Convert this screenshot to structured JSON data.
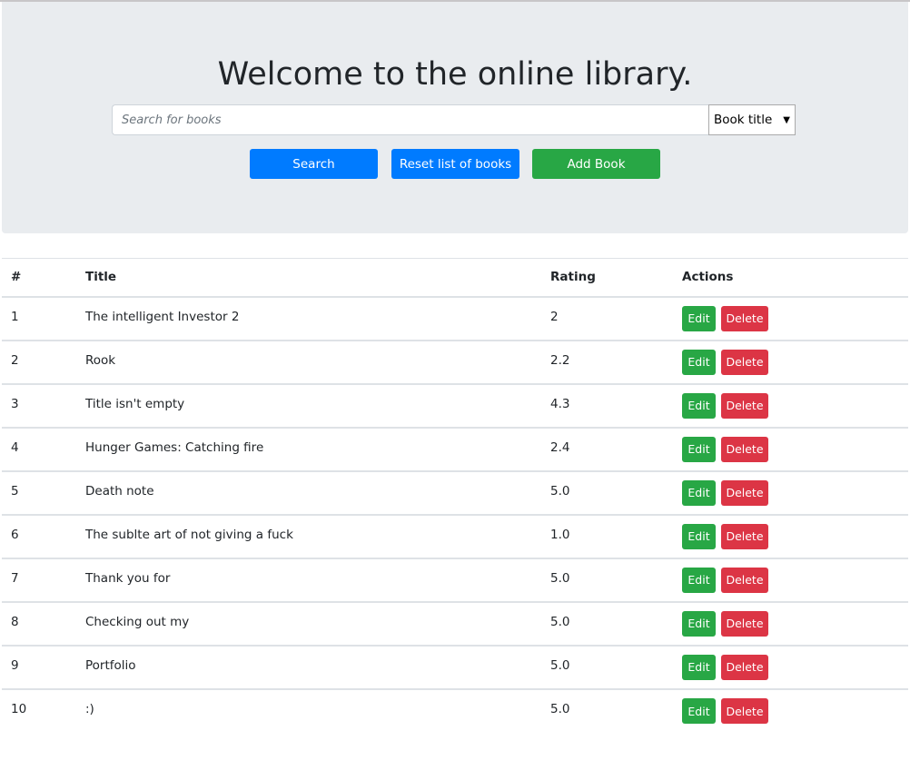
{
  "header": {
    "title": "Welcome to the online library.",
    "search_placeholder": "Search for books",
    "search_value": "",
    "filter_selected": "Book title",
    "buttons": {
      "search": "Search",
      "reset": "Reset list of books",
      "add": "Add Book"
    }
  },
  "table": {
    "columns": [
      "#",
      "Title",
      "Rating",
      "Actions"
    ],
    "edit_label": "Edit",
    "delete_label": "Delete",
    "rows": [
      {
        "num": "1",
        "title": "The intelligent Investor 2",
        "rating": "2"
      },
      {
        "num": "2",
        "title": "Rook",
        "rating": "2.2"
      },
      {
        "num": "3",
        "title": "Title isn't empty",
        "rating": "4.3"
      },
      {
        "num": "4",
        "title": "Hunger Games: Catching fire",
        "rating": "2.4"
      },
      {
        "num": "5",
        "title": "Death note",
        "rating": "5.0"
      },
      {
        "num": "6",
        "title": "The sublte art of not giving a fuck",
        "rating": "1.0"
      },
      {
        "num": "7",
        "title": "Thank you for",
        "rating": "5.0"
      },
      {
        "num": "8",
        "title": "Checking out my",
        "rating": "5.0"
      },
      {
        "num": "9",
        "title": "Portfolio",
        "rating": "5.0"
      },
      {
        "num": "10",
        "title": ":)",
        "rating": "5.0"
      }
    ]
  },
  "colors": {
    "primary": "#007bff",
    "success": "#28a745",
    "danger": "#dc3545",
    "jumbotron_bg": "#e9ecef"
  }
}
